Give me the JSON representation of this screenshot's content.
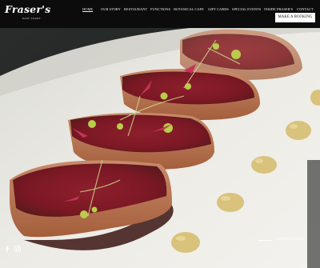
{
  "brand": {
    "name": "Fraser's",
    "tagline": "EAST COAST"
  },
  "nav": {
    "items": [
      {
        "label": "HOME",
        "active": true
      },
      {
        "label": "OUR STORY"
      },
      {
        "label": "RESTAURANT"
      },
      {
        "label": "FUNCTIONS"
      },
      {
        "label": "BOTANICAL CAFE"
      },
      {
        "label": "GIFT CARDS"
      },
      {
        "label": "SPECIAL EVENTS"
      },
      {
        "label": "INSIDE FRASER'S"
      },
      {
        "label": "CONTACT"
      }
    ],
    "cta_label": "MAKE A BOOKING"
  },
  "hero": {
    "image_icon": "seared-tuna-dish-photo"
  },
  "social": {
    "icons": [
      "facebook-icon",
      "instagram-icon"
    ]
  },
  "footer": {
    "latest_label": "LATEST EVENT"
  }
}
